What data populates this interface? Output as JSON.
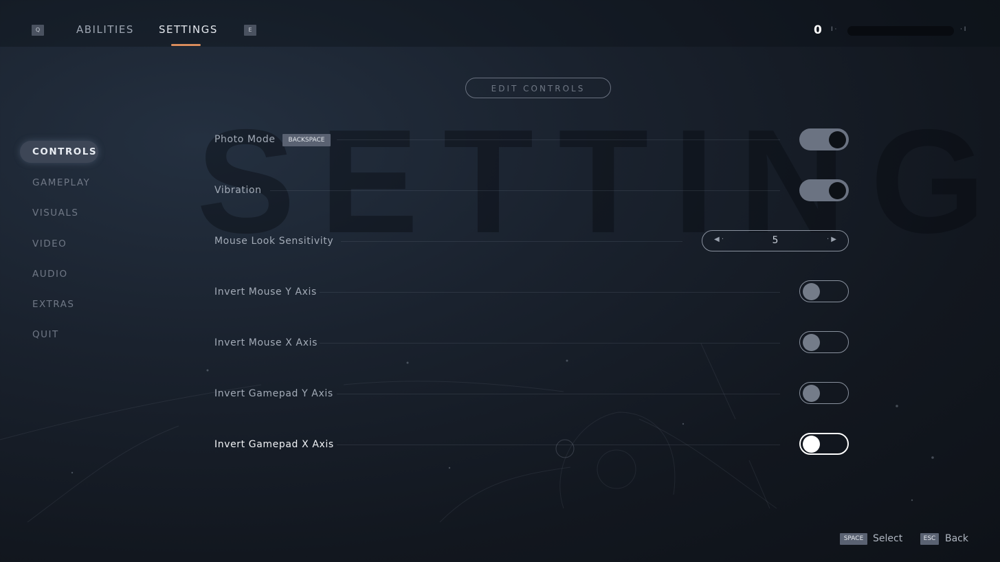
{
  "topbar": {
    "prev_key": "Q",
    "next_key": "E",
    "tabs": [
      {
        "label": "ABILITIES",
        "active": false
      },
      {
        "label": "SETTINGS",
        "active": true
      }
    ],
    "score": "0",
    "accent_color": "#d98c5c"
  },
  "background_title": "SETTINGS",
  "edit_controls_label": "EDIT CONTROLS",
  "sidebar": {
    "items": [
      {
        "label": "CONTROLS",
        "active": true
      },
      {
        "label": "GAMEPLAY",
        "active": false
      },
      {
        "label": "VISUALS",
        "active": false
      },
      {
        "label": "VIDEO",
        "active": false
      },
      {
        "label": "AUDIO",
        "active": false
      },
      {
        "label": "EXTRAS",
        "active": false
      },
      {
        "label": "QUIT",
        "active": false
      }
    ]
  },
  "settings": [
    {
      "label": "Photo Mode",
      "key_hint": "BACKSPACE",
      "type": "toggle",
      "value": "on"
    },
    {
      "label": "Vibration",
      "type": "toggle",
      "value": "on"
    },
    {
      "label": "Mouse Look Sensitivity",
      "type": "stepper",
      "value": "5"
    },
    {
      "label": "Invert Mouse Y Axis",
      "type": "toggle",
      "value": "off"
    },
    {
      "label": "Invert Mouse X Axis",
      "type": "toggle",
      "value": "off"
    },
    {
      "label": "Invert Gamepad Y Axis",
      "type": "toggle",
      "value": "off"
    },
    {
      "label": "Invert Gamepad X Axis",
      "type": "toggle",
      "value": "off",
      "focused": true
    }
  ],
  "footer": {
    "select_key": "SPACE",
    "select_label": "Select",
    "back_key": "ESC",
    "back_label": "Back"
  }
}
